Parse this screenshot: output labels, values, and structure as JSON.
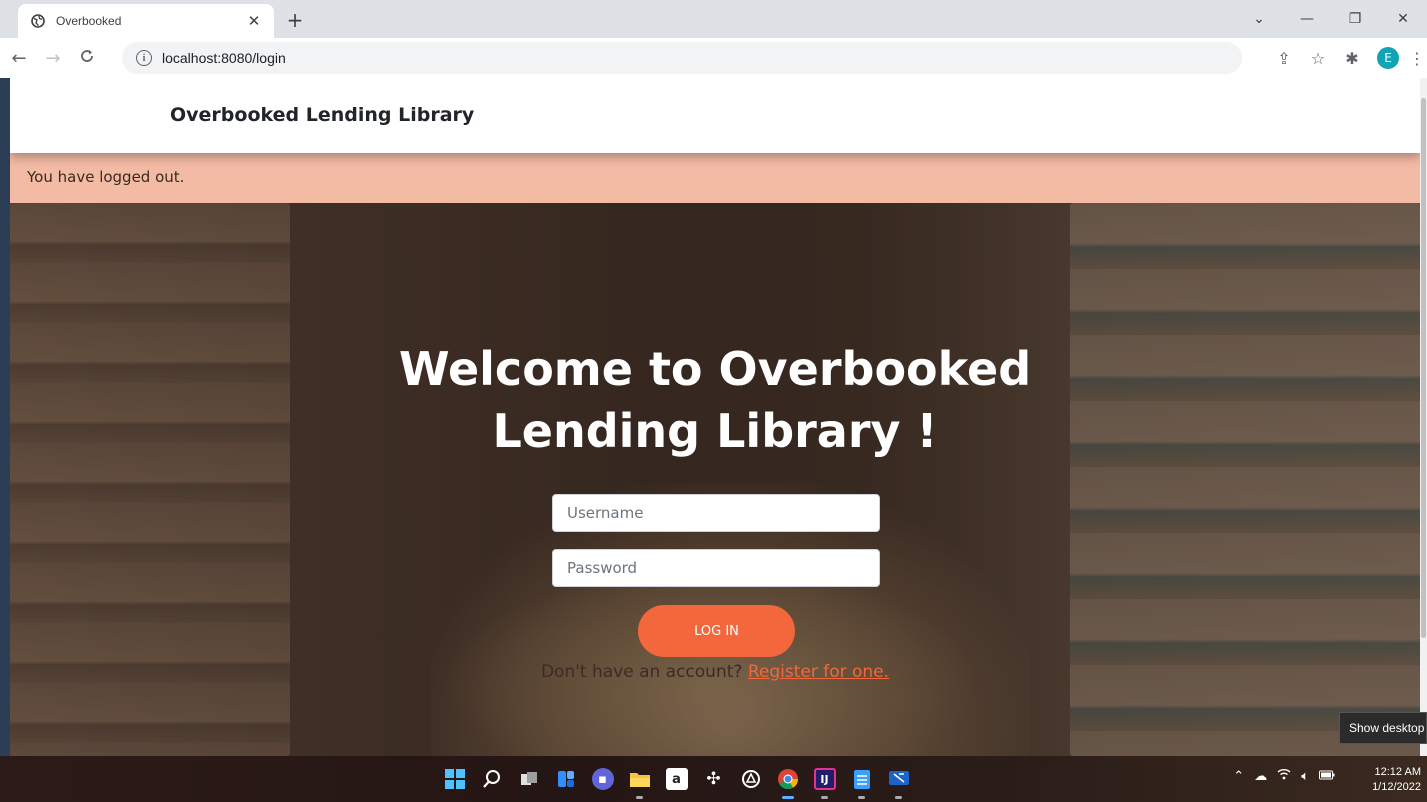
{
  "browser": {
    "tab_title": "Overbooked",
    "tab_close": "✕",
    "new_tab": "+",
    "url": "localhost:8080/login",
    "profile_initial": "E",
    "window_controls": {
      "dropdown": "⌄",
      "minimize": "—",
      "restore": "❐",
      "close": "✕"
    }
  },
  "navbar": {
    "brand": "Overbooked Lending Library"
  },
  "alert": {
    "message": "You have logged out."
  },
  "login": {
    "heading_line1": "Welcome to Overbooked",
    "heading_line2": "Lending Library !",
    "username_placeholder": "Username",
    "password_placeholder": "Password",
    "login_button": "LOG IN",
    "register_prompt": "Don't have an account? ",
    "register_link": "Register for one."
  },
  "tooltip": {
    "text": "Show desktop"
  },
  "taskbar": {
    "apps": [
      {
        "name": "start-icon"
      },
      {
        "name": "search-icon"
      },
      {
        "name": "task-view-icon"
      },
      {
        "name": "widgets-icon"
      },
      {
        "name": "chat-icon"
      },
      {
        "name": "file-explorer-icon"
      },
      {
        "name": "amazon-icon"
      },
      {
        "name": "dropbox-icon"
      },
      {
        "name": "app-icon"
      },
      {
        "name": "chrome-icon"
      },
      {
        "name": "intellij-icon"
      },
      {
        "name": "notepad-icon"
      },
      {
        "name": "remote-desktop-icon"
      }
    ],
    "time": "12:12 AM",
    "date": "1/12/2022"
  }
}
